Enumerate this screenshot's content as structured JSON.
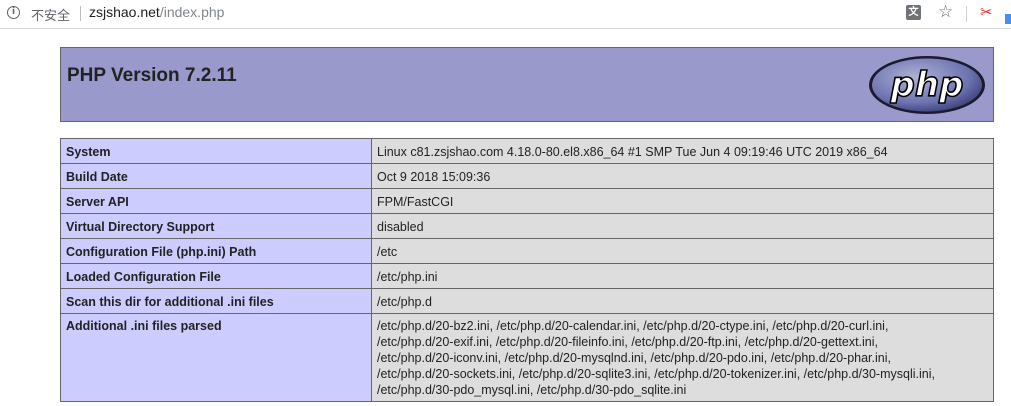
{
  "browser": {
    "security_label": "不安全",
    "url_host": "zsjshao.net",
    "url_path": "/index.php",
    "icons": [
      "info-icon",
      "translate-icon",
      "star-icon",
      "extension-icon"
    ]
  },
  "header": {
    "title": "PHP Version 7.2.11",
    "logo_text": "php",
    "colors": {
      "header_bg": "#9999cc",
      "key_bg": "#ccccff",
      "value_bg": "#dddddd",
      "border": "#666666"
    }
  },
  "rows": [
    {
      "key": "System",
      "value": [
        "Linux c81.zsjshao.com 4.18.0-80.el8.x86_64 #1 SMP Tue Jun 4 09:19:46 UTC 2019 x86_64"
      ]
    },
    {
      "key": "Build Date",
      "value": [
        "Oct 9 2018 15:09:36"
      ]
    },
    {
      "key": "Server API",
      "value": [
        "FPM/FastCGI"
      ]
    },
    {
      "key": "Virtual Directory Support",
      "value": [
        "disabled"
      ]
    },
    {
      "key": "Configuration File (php.ini) Path",
      "value": [
        "/etc"
      ]
    },
    {
      "key": "Loaded Configuration File",
      "value": [
        "/etc/php.ini"
      ]
    },
    {
      "key": "Scan this dir for additional .ini files",
      "value": [
        "/etc/php.d"
      ]
    },
    {
      "key": "Additional .ini files parsed",
      "value": [
        "/etc/php.d/20-bz2.ini, /etc/php.d/20-calendar.ini, /etc/php.d/20-ctype.ini, /etc/php.d/20-curl.ini,",
        "/etc/php.d/20-exif.ini, /etc/php.d/20-fileinfo.ini, /etc/php.d/20-ftp.ini, /etc/php.d/20-gettext.ini,",
        "/etc/php.d/20-iconv.ini, /etc/php.d/20-mysqlnd.ini, /etc/php.d/20-pdo.ini, /etc/php.d/20-phar.ini,",
        "/etc/php.d/20-sockets.ini, /etc/php.d/20-sqlite3.ini, /etc/php.d/20-tokenizer.ini, /etc/php.d/30-mysqli.ini,",
        "/etc/php.d/30-pdo_mysql.ini, /etc/php.d/30-pdo_sqlite.ini"
      ]
    }
  ]
}
